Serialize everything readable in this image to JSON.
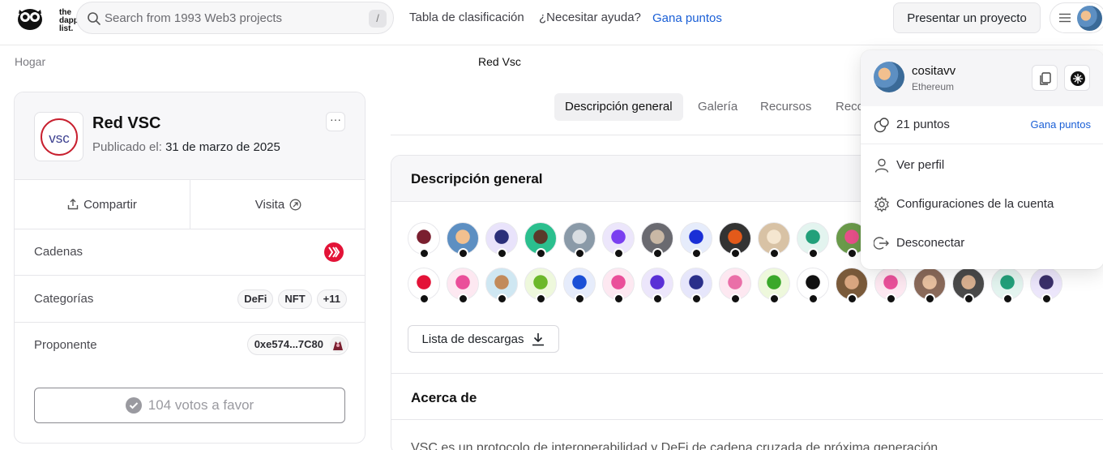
{
  "header": {
    "logo_text": [
      "the",
      "dapp",
      "list."
    ],
    "search_placeholder": "Search from 1993 Web3 projects",
    "search_shortcut": "/",
    "nav": [
      "Tabla de clasificación",
      "¿Necesitar ayuda?",
      "Gana puntos"
    ],
    "submit_label": "Presentar un proyecto"
  },
  "breadcrumb": {
    "home": "Hogar",
    "current": "Red Vsc"
  },
  "project": {
    "name": "Red VSC",
    "logo_text": "vsc",
    "published_label": "Publicado el:",
    "published_date": "31 de marzo de 2025",
    "more": "···",
    "share_label": "Compartir",
    "visit_label": "Visita",
    "chains_label": "Cadenas",
    "categories_label": "Categorías",
    "categories": [
      "DeFi",
      "NFT",
      "+11"
    ],
    "proposer_label": "Proponente",
    "proposer_address": "0xe574...7C80",
    "votes_label": "104 votos a favor"
  },
  "tabs": [
    "Descripción general",
    "Galería",
    "Recursos",
    "Reco"
  ],
  "overview": {
    "title": "Descripción general",
    "download_label": "Lista de descargas",
    "about_title": "Acerca de",
    "about_text": "VSC es un protocolo de interoperabilidad y DeFi de cadena cruzada de próxima generación"
  },
  "dropdown": {
    "username": "cositavv",
    "chain": "Ethereum",
    "points": "21 puntos",
    "earn_label": "Gana puntos",
    "items": [
      "Ver perfil",
      "Configuraciones de la cuenta",
      "Desconectar"
    ]
  },
  "colors": {
    "accent": "#1a5fd6",
    "hive_red": "#e31337"
  }
}
